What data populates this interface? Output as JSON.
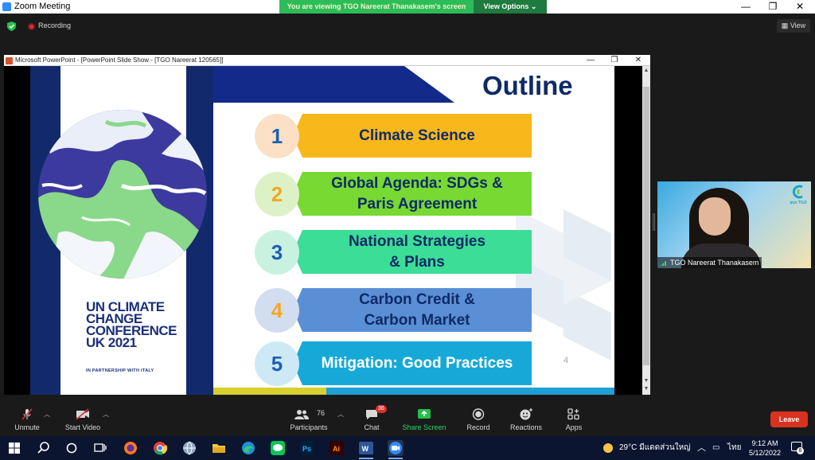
{
  "window": {
    "title": "Zoom Meeting"
  },
  "share_banner": {
    "text": "You are viewing TGO Nareerat Thanakasem's screen",
    "view_options": "View Options"
  },
  "recording": {
    "label": "Recording"
  },
  "view_button": {
    "label": "View"
  },
  "ppt": {
    "title": "Microsoft PowerPoint - [PowerPoint Slide Show - [TGO Nareerat 120565]]",
    "slide": {
      "title": "Outline",
      "cop": {
        "lines": [
          "UN CLIMATE",
          "CHANGE",
          "CONFERENCE",
          "UK 2021"
        ],
        "subtitle": "IN PARTNERSHIP WITH ITALY"
      },
      "items": [
        {
          "number": "1",
          "text_lines": [
            "Climate Science"
          ],
          "bar_color": "#f8b81c",
          "circle_color": "#fbe0c6",
          "num_color": "#1c5fb3"
        },
        {
          "number": "2",
          "text_lines": [
            "Global Agenda: SDGs &",
            "Paris Agreement"
          ],
          "bar_color": "#77d932",
          "circle_color": "#dcf2c6",
          "num_color": "#f5a623"
        },
        {
          "number": "3",
          "text_lines": [
            "National Strategies",
            "& Plans"
          ],
          "bar_color": "#3cdd96",
          "circle_color": "#c8f2df",
          "num_color": "#1c5fb3"
        },
        {
          "number": "4",
          "text_lines": [
            "Carbon Credit &",
            "Carbon Market"
          ],
          "bar_color": "#5a8fd6",
          "circle_color": "#d2def0",
          "num_color": "#f5a623"
        },
        {
          "number": "5",
          "text_lines": [
            "Mitigation: Good Practices"
          ],
          "bar_color": "#16a9d8",
          "circle_color": "#cde9f5",
          "num_color": "#1c5fb3",
          "text_color": "#ffffff"
        }
      ],
      "page_number": "4"
    }
  },
  "video": {
    "name": "TGO Nareerat Thanakasem",
    "logo_text": "อบก TGO"
  },
  "toolbar": {
    "unmute": "Unmute",
    "start_video": "Start Video",
    "participants": "Participants",
    "participants_count": "76",
    "chat": "Chat",
    "chat_badge": "36",
    "share_screen": "Share Screen",
    "record": "Record",
    "reactions": "Reactions",
    "apps": "Apps",
    "leave": "Leave"
  },
  "taskbar": {
    "weather": "29°C มีแดดส่วนใหญ่",
    "language": "ไทย",
    "time": "9:12 AM",
    "date": "5/12/2022",
    "notification_count": "8"
  }
}
